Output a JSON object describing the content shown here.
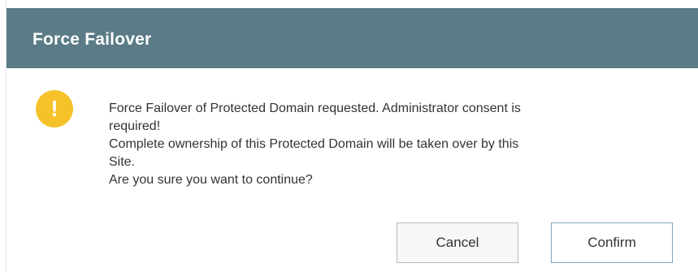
{
  "dialog": {
    "title": "Force Failover",
    "icon": "warning-icon",
    "icon_color": "#f6c22a",
    "icon_glyph": "!",
    "message_lines": [
      "Force Failover of Protected Domain requested. Administrator consent is",
      "required!",
      "Complete ownership of this Protected Domain will be taken over by this",
      "Site.",
      "Are you sure you want to continue?"
    ],
    "cancel_label": "Cancel",
    "confirm_label": "Confirm"
  },
  "colors": {
    "titlebar": "#5b7b87",
    "title_text": "#ffffff",
    "body_text": "#333333"
  }
}
